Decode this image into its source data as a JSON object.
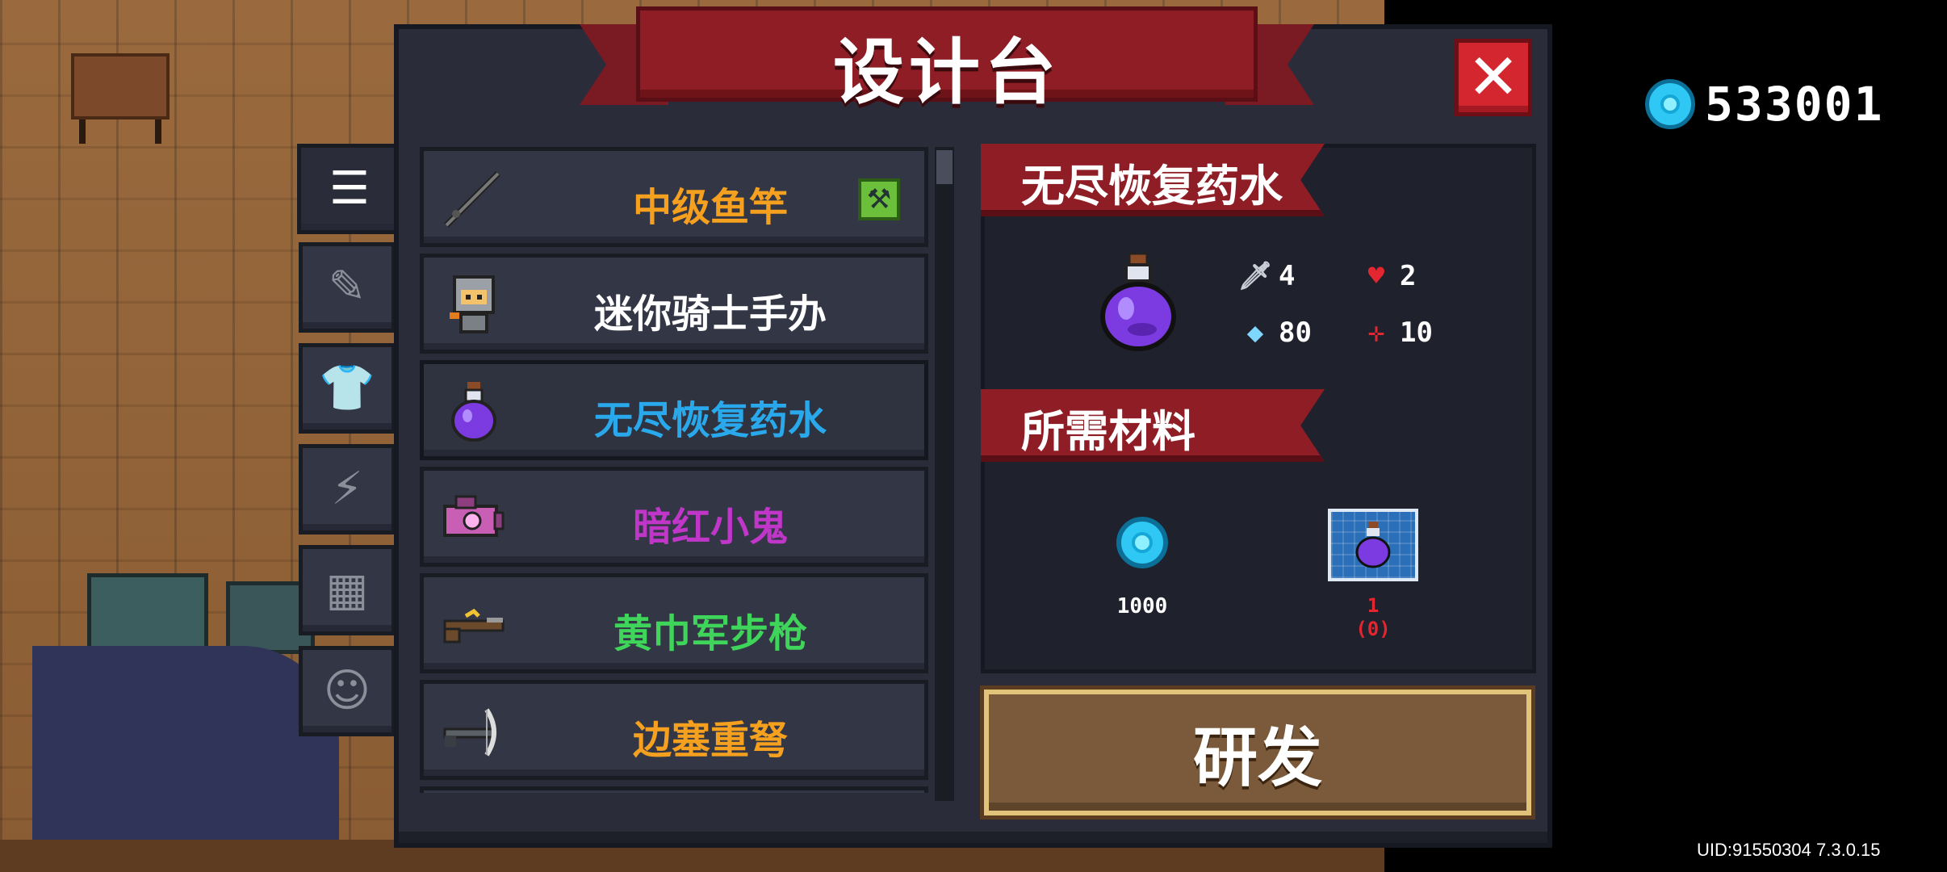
{
  "window": {
    "title": "设计台"
  },
  "currency": {
    "value": "533001",
    "icon": "gem-icon"
  },
  "close_button": {
    "label": "✕"
  },
  "side_tabs": [
    {
      "icon": "list-icon",
      "glyph": "☰",
      "active": true
    },
    {
      "icon": "weapon-icon",
      "glyph": "✎",
      "active": false
    },
    {
      "icon": "armor-icon",
      "glyph": "👕",
      "active": false
    },
    {
      "icon": "lightning-icon",
      "glyph": "⚡",
      "active": false
    },
    {
      "icon": "material-icon",
      "glyph": "▦",
      "active": false
    },
    {
      "icon": "pet-icon",
      "glyph": "☺",
      "active": false
    }
  ],
  "items": [
    {
      "name": "中级鱼竿",
      "color": "#f5a01e",
      "icon": "fishing-rod-icon",
      "badge": "pickaxe-icon"
    },
    {
      "name": "迷你骑士手办",
      "color": "#ffffff",
      "icon": "knight-figure-icon"
    },
    {
      "name": "无尽恢复药水",
      "color": "#29a9ec",
      "icon": "potion-icon",
      "selected": true
    },
    {
      "name": "暗红小鬼",
      "color": "#c036c9",
      "icon": "camera-gun-icon"
    },
    {
      "name": "黄巾军步枪",
      "color": "#3fd45a",
      "icon": "rifle-icon"
    },
    {
      "name": "边塞重弩",
      "color": "#f5a01e",
      "icon": "crossbow-icon"
    }
  ],
  "detail": {
    "item_title": "无尽恢复药水",
    "stats": {
      "attack": "4",
      "health": "2",
      "energy": "80",
      "crit": "10"
    },
    "materials_title": "所需材料",
    "materials": [
      {
        "icon": "gem-icon",
        "count": "1000"
      },
      {
        "icon": "blueprint-potion-icon",
        "count": "1",
        "owned": "(0)"
      }
    ],
    "develop_button": "研发"
  },
  "uid": "UID:91550304 7.3.0.15"
}
